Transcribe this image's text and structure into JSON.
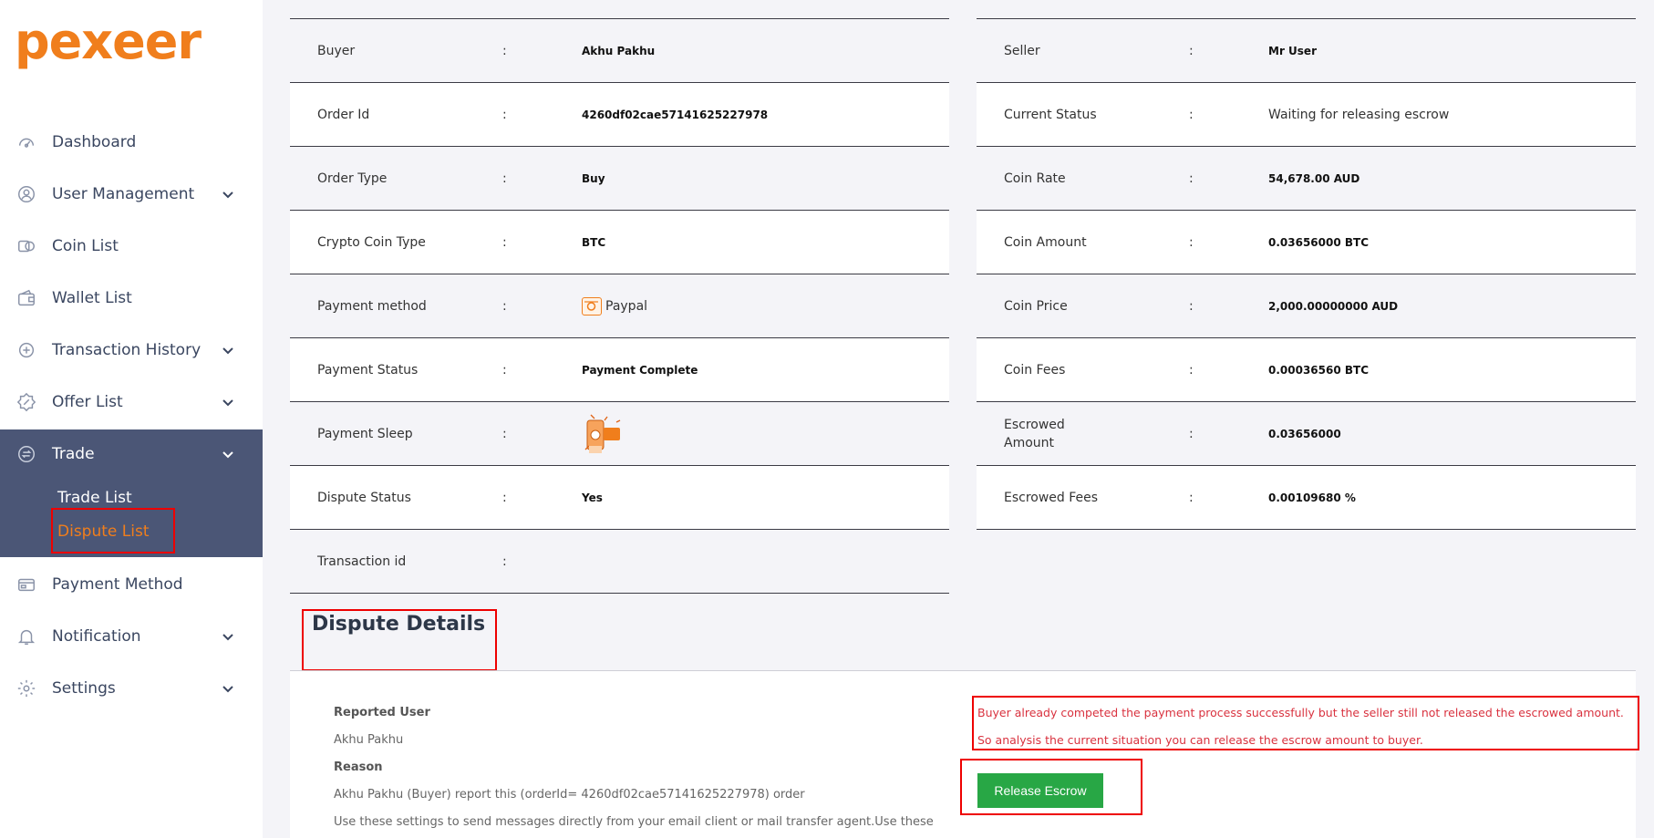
{
  "brand": {
    "logo_text": "pexeer",
    "accent": "#f07e1c"
  },
  "sidebar": {
    "items": [
      {
        "label": "Dashboard",
        "icon": "speedometer-icon"
      },
      {
        "label": "User Management",
        "icon": "user-circle-icon"
      },
      {
        "label": "Coin List",
        "icon": "coins-icon"
      },
      {
        "label": "Wallet List",
        "icon": "wallet-icon"
      },
      {
        "label": "Transaction History",
        "icon": "transaction-icon"
      },
      {
        "label": "Offer List",
        "icon": "offer-tag-icon"
      },
      {
        "label": "Trade",
        "icon": "exchange-icon"
      },
      {
        "label": "Payment Method",
        "icon": "payment-icon"
      },
      {
        "label": "Notification",
        "icon": "bell-icon"
      },
      {
        "label": "Settings",
        "icon": "gear-icon"
      }
    ],
    "trade_sub": [
      {
        "label": "Trade List"
      },
      {
        "label": "Dispute List"
      }
    ]
  },
  "order_left": [
    {
      "key": "Buyer",
      "sep": ":",
      "value": "Akhu Pakhu"
    },
    {
      "key": "Order Id",
      "sep": ":",
      "value": "4260df02cae57141625227978"
    },
    {
      "key": "Order Type",
      "sep": ":",
      "value": "Buy"
    },
    {
      "key": "Crypto Coin Type",
      "sep": ":",
      "value": "BTC"
    },
    {
      "key": "Payment method",
      "sep": ":",
      "value": "Paypal"
    },
    {
      "key": "Payment Status",
      "sep": ":",
      "value": "Payment Complete"
    },
    {
      "key": "Payment Sleep",
      "sep": ":",
      "value": ""
    },
    {
      "key": "Dispute Status",
      "sep": ":",
      "value": "Yes"
    },
    {
      "key": "Transaction id",
      "sep": ":",
      "value": ""
    }
  ],
  "order_right": [
    {
      "key": "Seller",
      "sep": ":",
      "value": "Mr User"
    },
    {
      "key": "Current Status",
      "sep": ":",
      "value": "Waiting for releasing escrow"
    },
    {
      "key": "Coin Rate",
      "sep": ":",
      "value": "54,678.00 AUD"
    },
    {
      "key": "Coin Amount",
      "sep": ":",
      "value": "0.03656000 BTC"
    },
    {
      "key": "Coin Price",
      "sep": ":",
      "value": "2,000.00000000 AUD"
    },
    {
      "key": "Coin Fees",
      "sep": ":",
      "value": "0.00036560 BTC"
    },
    {
      "key": "Escrowed Amount",
      "sep": ":",
      "value": "0.03656000"
    },
    {
      "key": "Escrowed Fees",
      "sep": ":",
      "value": "0.00109680 %"
    }
  ],
  "dispute": {
    "title": "Dispute Details",
    "reported_user_label": "Reported User",
    "reported_user": "Akhu Pakhu",
    "reason_label": "Reason",
    "reason_line1": "Akhu Pakhu (Buyer) report this (orderId= 4260df02cae57141625227978) order",
    "reason_line2": "Use these settings to send messages directly from your email client or mail transfer agent.Use these",
    "message_line1": "Buyer already competed the payment process successfully but the seller still not released the escrowed amount.",
    "message_line2": "So analysis the current situation you can release the escrow amount to buyer.",
    "release_button": "Release Escrow"
  }
}
